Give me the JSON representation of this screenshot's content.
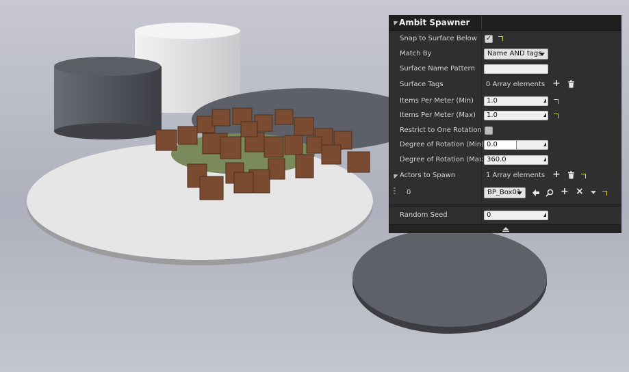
{
  "panel": {
    "title": "Ambit Spawner",
    "rows": {
      "snap_to_surface": {
        "label": "Snap to Surface Below",
        "checked": true,
        "check_glyph": "✓"
      },
      "match_by": {
        "label": "Match By",
        "value": "Name AND tags"
      },
      "surface_name_pattern": {
        "label": "Surface Name Pattern",
        "value": ""
      },
      "surface_tags": {
        "label": "Surface Tags",
        "value": "0 Array elements"
      },
      "items_per_meter_min": {
        "label": "Items Per Meter (Min)",
        "value": "1.0"
      },
      "items_per_meter_max": {
        "label": "Items Per Meter (Max)",
        "value": "1.0"
      },
      "restrict_rotation": {
        "label": "Restrict to One Rotation",
        "checked": false
      },
      "rotation_min": {
        "label": "Degree of Rotation (Min)",
        "value": "0.0",
        "fill": 0.0
      },
      "rotation_max": {
        "label": "Degree of Rotation (Max)",
        "value": "360.0",
        "fill": 1.0
      },
      "actors_to_spawn": {
        "label": "Actors to Spawn",
        "value": "1 Array elements"
      },
      "actor_element": {
        "index": "0",
        "value": "BP_Box01"
      },
      "random_seed": {
        "label": "Random Seed",
        "value": "0"
      }
    }
  },
  "icons": {
    "add": "+",
    "delete": "trash-icon",
    "reset": "reset-arrow-icon",
    "browse": "arrow-left-icon",
    "find": "search-icon",
    "clear": "×",
    "collapse": "chevron-up-icon"
  },
  "colors": {
    "panel_bg": "#2f2f2f",
    "header_bg": "#1f1f1f",
    "reset_yellow": "#d7d32a",
    "field_bg": "#f0f0f0"
  }
}
